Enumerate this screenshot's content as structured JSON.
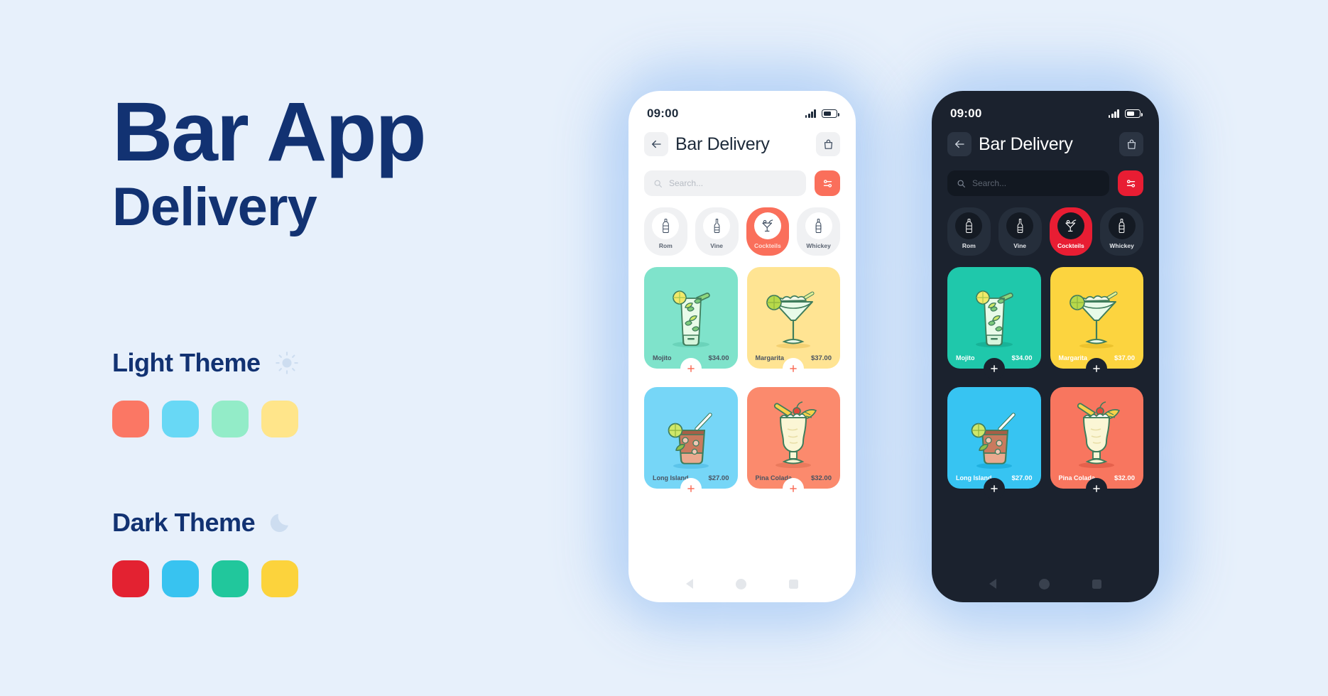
{
  "hero": {
    "title_line1": "Bar App",
    "title_line2": "Delivery",
    "title_color": "#123272"
  },
  "themes": [
    {
      "label": "Light Theme",
      "icon": "sun-icon",
      "swatches": [
        "#fb7764",
        "#68d8f5",
        "#93ecc8",
        "#ffe58a"
      ]
    },
    {
      "label": "Dark Theme",
      "icon": "moon-icon",
      "swatches": [
        "#e32231",
        "#38c3f0",
        "#21c79c",
        "#fcd33c"
      ]
    }
  ],
  "phones": [
    {
      "variant": "light",
      "status": {
        "time": "09:00",
        "signal": "signal-bars-icon",
        "battery": "battery-icon"
      },
      "appbar": {
        "back": "back-arrow-icon",
        "title": "Bar Delivery",
        "cart": "shopping-bag-icon"
      },
      "search": {
        "placeholder": "Search...",
        "icon": "search-icon",
        "filter_icon": "filter-sliders-icon",
        "filter_color": "#fa6f5b"
      },
      "categories": [
        {
          "label": "Rom",
          "icon": "rum-bottle-icon",
          "active": false
        },
        {
          "label": "Vine",
          "icon": "wine-bottle-icon",
          "active": false
        },
        {
          "label": "Cockteils",
          "icon": "cocktail-glass-icon",
          "active": true
        },
        {
          "label": "Whickey",
          "icon": "whiskey-bottle-icon",
          "active": false
        }
      ],
      "products": [
        {
          "name": "Mojito",
          "price": "$34.00",
          "bg": "#7fe3cb",
          "art": "mojito-glass-icon",
          "col": 0
        },
        {
          "name": "Long Island",
          "price": "$27.00",
          "bg": "#76d6f7",
          "art": "long-island-glass-icon",
          "col": 0
        },
        {
          "name": "Margarita",
          "price": "$37.00",
          "bg": "#ffe493",
          "art": "margarita-glass-icon",
          "col": 1
        },
        {
          "name": "Pina Colada",
          "price": "$32.00",
          "bg": "#fb8a6d",
          "art": "pina-colada-glass-icon",
          "col": 1
        }
      ],
      "nav": {
        "back": "nav-back-icon",
        "home": "nav-home-icon",
        "recents": "nav-recents-icon"
      }
    },
    {
      "variant": "dark",
      "status": {
        "time": "09:00",
        "signal": "signal-bars-icon",
        "battery": "battery-icon"
      },
      "appbar": {
        "back": "back-arrow-icon",
        "title": "Bar Delivery",
        "cart": "shopping-bag-icon"
      },
      "search": {
        "placeholder": "Search...",
        "icon": "search-icon",
        "filter_icon": "filter-sliders-icon",
        "filter_color": "#e81d33"
      },
      "categories": [
        {
          "label": "Rom",
          "icon": "rum-bottle-icon",
          "active": false
        },
        {
          "label": "Vine",
          "icon": "wine-bottle-icon",
          "active": false
        },
        {
          "label": "Cockteils",
          "icon": "cocktail-glass-icon",
          "active": true
        },
        {
          "label": "Whickey",
          "icon": "whiskey-bottle-icon",
          "active": false
        }
      ],
      "products": [
        {
          "name": "Mojito",
          "price": "$34.00",
          "bg": "#1fc8ab",
          "art": "mojito-glass-icon",
          "col": 0
        },
        {
          "name": "Long Island",
          "price": "$27.00",
          "bg": "#37c4f2",
          "art": "long-island-glass-icon",
          "col": 0
        },
        {
          "name": "Margarita",
          "price": "$37.00",
          "bg": "#fcd43f",
          "art": "margarita-glass-icon",
          "col": 1
        },
        {
          "name": "Pina Colada",
          "price": "$32.00",
          "bg": "#f8765f",
          "art": "pina-colada-glass-icon",
          "col": 1
        }
      ],
      "nav": {
        "back": "nav-back-icon",
        "home": "nav-home-icon",
        "recents": "nav-recents-icon"
      }
    }
  ]
}
